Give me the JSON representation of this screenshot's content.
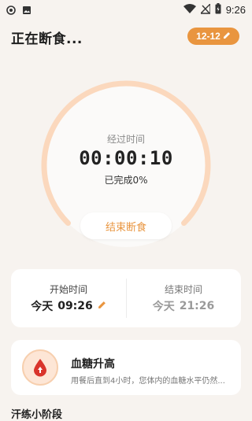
{
  "status_bar": {
    "time": "9:26",
    "icons": [
      "record-icon",
      "image-icon",
      "wifi-icon",
      "no-signal-icon",
      "battery-icon"
    ]
  },
  "header": {
    "title": "正在断食...",
    "date_label": "12-12",
    "edit_icon": "pencil-icon"
  },
  "timer": {
    "elapsed_label": "经过时间",
    "elapsed_time": "00:00:10",
    "completed_prefix": "已完成",
    "completed_percent": "0%",
    "progress_fraction": 0.0
  },
  "actions": {
    "end_fast_label": "结束断食"
  },
  "times": {
    "start_label": "开始时间",
    "start_day": "今天",
    "start_time": "09:26",
    "end_label": "结束时间",
    "end_day": "今天",
    "end_time": "21:26"
  },
  "info_card": {
    "title": "血糖升高",
    "description": "用餐后直到4小时，您体内的血糖水平仍然...",
    "icon": "blood-drop-up-icon"
  },
  "bottom": {
    "partial_text": "汗练小阶段"
  },
  "colors": {
    "accent": "#e9953f",
    "ring": "#fbd8bd",
    "background": "#f7f3ef"
  }
}
